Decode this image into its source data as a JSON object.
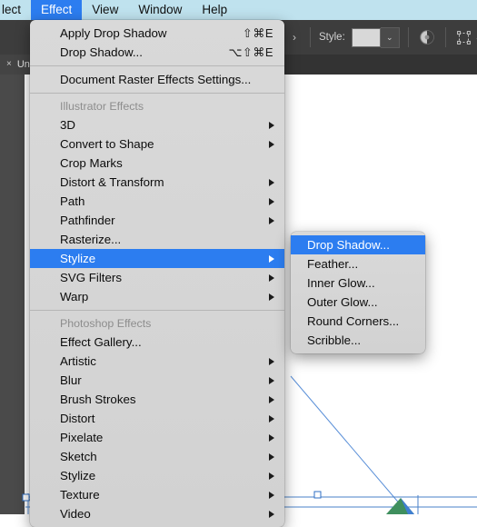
{
  "menubar": {
    "items": [
      {
        "label": "lect",
        "active": false,
        "clipped": true
      },
      {
        "label": "Effect",
        "active": true,
        "clipped": false
      },
      {
        "label": "View",
        "active": false,
        "clipped": false
      },
      {
        "label": "Window",
        "active": false,
        "clipped": false
      },
      {
        "label": "Help",
        "active": false,
        "clipped": false
      }
    ]
  },
  "control_bar": {
    "style_label": "Style:",
    "style_value": "",
    "chevron": "›",
    "dropdown_caret": "⌄",
    "transform_caret": "⌄"
  },
  "document_tab": {
    "close": "×",
    "title": "Un"
  },
  "effect_menu": {
    "top_items": [
      {
        "label": "Apply Drop Shadow",
        "shortcut": "⇧⌘E",
        "submenu": false
      },
      {
        "label": "Drop Shadow...",
        "shortcut": "⌥⇧⌘E",
        "submenu": false
      }
    ],
    "raster_item": {
      "label": "Document Raster Effects Settings...",
      "shortcut": "",
      "submenu": false
    },
    "illustrator_header": "Illustrator Effects",
    "illustrator_items": [
      {
        "label": "3D",
        "submenu": true,
        "highlighted": false
      },
      {
        "label": "Convert to Shape",
        "submenu": true,
        "highlighted": false
      },
      {
        "label": "Crop Marks",
        "submenu": false,
        "highlighted": false
      },
      {
        "label": "Distort & Transform",
        "submenu": true,
        "highlighted": false
      },
      {
        "label": "Path",
        "submenu": true,
        "highlighted": false
      },
      {
        "label": "Pathfinder",
        "submenu": true,
        "highlighted": false
      },
      {
        "label": "Rasterize...",
        "submenu": false,
        "highlighted": false
      },
      {
        "label": "Stylize",
        "submenu": true,
        "highlighted": true
      },
      {
        "label": "SVG Filters",
        "submenu": true,
        "highlighted": false
      },
      {
        "label": "Warp",
        "submenu": true,
        "highlighted": false
      }
    ],
    "photoshop_header": "Photoshop Effects",
    "photoshop_items": [
      {
        "label": "Effect Gallery...",
        "submenu": false,
        "highlighted": false
      },
      {
        "label": "Artistic",
        "submenu": true,
        "highlighted": false
      },
      {
        "label": "Blur",
        "submenu": true,
        "highlighted": false
      },
      {
        "label": "Brush Strokes",
        "submenu": true,
        "highlighted": false
      },
      {
        "label": "Distort",
        "submenu": true,
        "highlighted": false
      },
      {
        "label": "Pixelate",
        "submenu": true,
        "highlighted": false
      },
      {
        "label": "Sketch",
        "submenu": true,
        "highlighted": false
      },
      {
        "label": "Stylize",
        "submenu": true,
        "highlighted": false
      },
      {
        "label": "Texture",
        "submenu": true,
        "highlighted": false
      },
      {
        "label": "Video",
        "submenu": true,
        "highlighted": false
      }
    ]
  },
  "stylize_submenu": {
    "items": [
      {
        "label": "Drop Shadow...",
        "highlighted": true
      },
      {
        "label": "Feather...",
        "highlighted": false
      },
      {
        "label": "Inner Glow...",
        "highlighted": false
      },
      {
        "label": "Outer Glow...",
        "highlighted": false
      },
      {
        "label": "Round Corners...",
        "highlighted": false
      },
      {
        "label": "Scribble...",
        "highlighted": false
      }
    ]
  },
  "colors": {
    "menubar_bg": "#bfe2ee",
    "highlight_blue": "#2c7df0",
    "menu_bg": "#d6d6d6",
    "chrome_dark": "#3a3a3a",
    "selection_blue": "#3f7fd1",
    "artwork_green": "#3f8f5e"
  }
}
